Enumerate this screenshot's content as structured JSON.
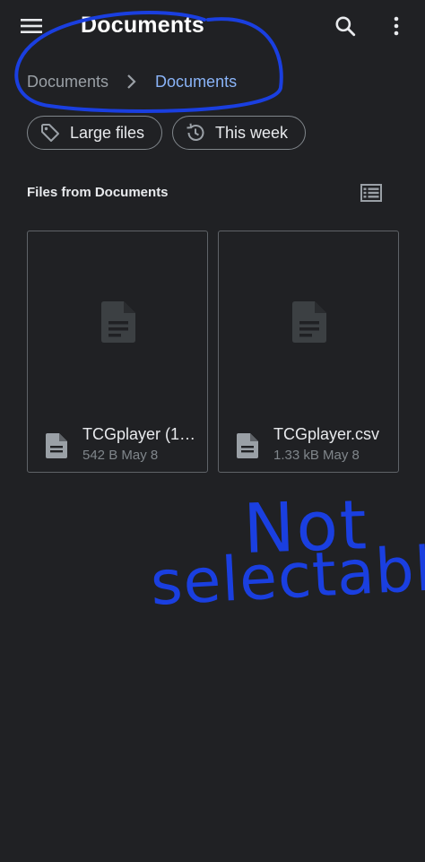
{
  "app_bar": {
    "title": "Documents",
    "menu_icon": "hamburger-menu-icon",
    "search_icon": "search-icon",
    "more_icon": "more-vert-icon"
  },
  "breadcrumb": {
    "root": "Documents",
    "separator_icon": "chevron-right-icon",
    "current": "Documents"
  },
  "filters": [
    {
      "label": "Large files",
      "icon": "tag-icon"
    },
    {
      "label": "This week",
      "icon": "history-icon"
    }
  ],
  "section": {
    "title": "Files from Documents",
    "view_toggle_icon": "list-view-icon"
  },
  "files": [
    {
      "name": "TCGplayer (1…",
      "size": "542 B",
      "date": "May 8",
      "icon": "document-icon"
    },
    {
      "name": "TCGplayer.csv",
      "size": "1.33 kB",
      "date": "May 8",
      "icon": "document-icon"
    }
  ],
  "annotation": {
    "line1": "Not",
    "line2": "selectable",
    "ink_color": "#1a3fe0"
  },
  "colors": {
    "background": "#202124",
    "accent": "#8ab4f8",
    "border": "#5f6368"
  }
}
